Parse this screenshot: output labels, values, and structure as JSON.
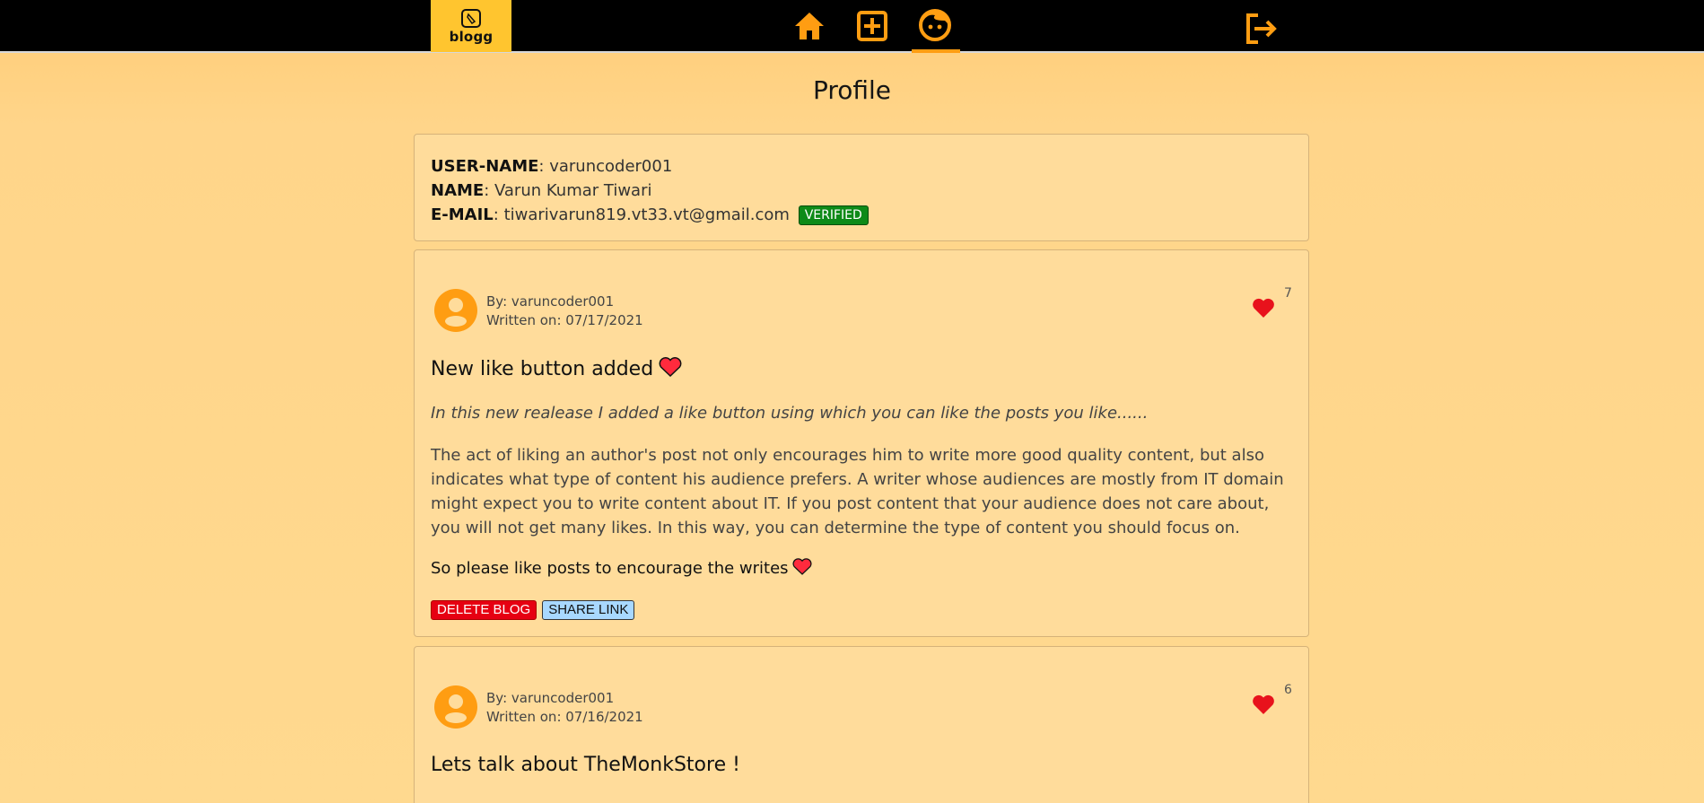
{
  "navbar": {
    "logo_text": "blogg",
    "icons": [
      "home-icon",
      "add-post-icon",
      "profile-icon",
      "logout-icon"
    ],
    "active": "profile",
    "accent": "#ff9d12"
  },
  "page": {
    "title": "Profile"
  },
  "user": {
    "username_label": "USER-NAME",
    "username": ": varuncoder001",
    "name_label": "NAME",
    "name": ": Varun Kumar Tiwari",
    "email_label": "E-MAIL",
    "email": ": tiwarivarun819.vt33.vt@gmail.com",
    "verified": "VERIFIED"
  },
  "posts": [
    {
      "by": "By: varuncoder001",
      "written": "Written on: 07/17/2021",
      "likes": "7",
      "title": "New like button added",
      "summary": "In this new realease I added a like button using which you can like the posts you like......",
      "body": "The act of liking an author's post not only encourages him to write more good quality content, but also indicates what type of content his audience prefers. A writer whose audiences are mostly from IT domain might expect you to write content about IT. If you post content that your audience does not care about, you will not get many likes. In this way, you can determine the type of content you should focus on.",
      "outro": "So please like posts to encourage the writes",
      "delete_label": "DELETE BLOG",
      "share_label": "SHARE LINK"
    },
    {
      "by": "By: varuncoder001",
      "written": "Written on: 07/16/2021",
      "likes": "6",
      "title": "Lets talk about TheMonkStore !"
    }
  ]
}
